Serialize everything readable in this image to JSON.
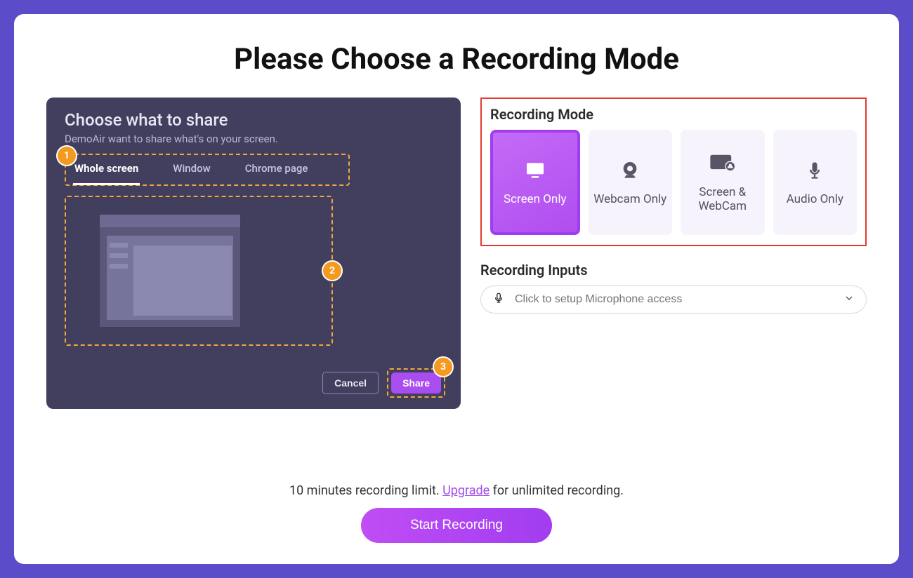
{
  "title": "Please Choose a Recording Mode",
  "preview": {
    "heading": "Choose what to share",
    "sub": "DemoAir want to share what's on your screen.",
    "tabs": [
      "Whole screen",
      "Window",
      "Chrome page"
    ],
    "active_tab_index": 0,
    "steps": {
      "s1": "1",
      "s2": "2",
      "s3": "3"
    },
    "cancel": "Cancel",
    "share": "Share"
  },
  "modes": {
    "label": "Recording Mode",
    "items": [
      {
        "label": "Screen Only",
        "selected": true
      },
      {
        "label": "Webcam Only",
        "selected": false
      },
      {
        "label": "Screen & WebCam",
        "selected": false
      },
      {
        "label": "Audio Only",
        "selected": false
      }
    ]
  },
  "inputs": {
    "label": "Recording Inputs",
    "placeholder": "Click to setup Microphone access"
  },
  "footer": {
    "limit_pre": "10 minutes recording limit. ",
    "upgrade": "Upgrade",
    "limit_post": " for unlimited recording.",
    "start": "Start Recording"
  }
}
